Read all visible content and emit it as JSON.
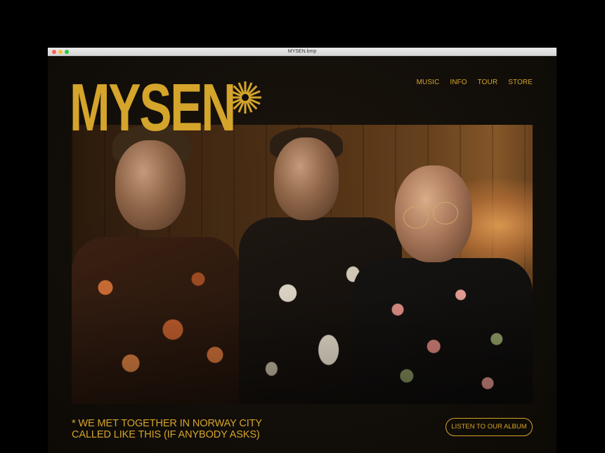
{
  "window": {
    "title": "MYSEN.bmp"
  },
  "brand": {
    "logo_text": "MYSEN",
    "accent_color": "#d4a42b"
  },
  "nav": {
    "items": [
      {
        "label": "MUSIC"
      },
      {
        "label": "INFO"
      },
      {
        "label": "TOUR"
      },
      {
        "label": "STORE"
      }
    ]
  },
  "hero": {
    "image_icon": "band-photo"
  },
  "tagline": {
    "line1": "* WE MET TOGETHER IN NORWAY CITY",
    "line2": "CALLED LIKE THIS (IF ANYBODY ASKS)"
  },
  "cta": {
    "label": "LISTEN TO OUR ALBUM"
  }
}
